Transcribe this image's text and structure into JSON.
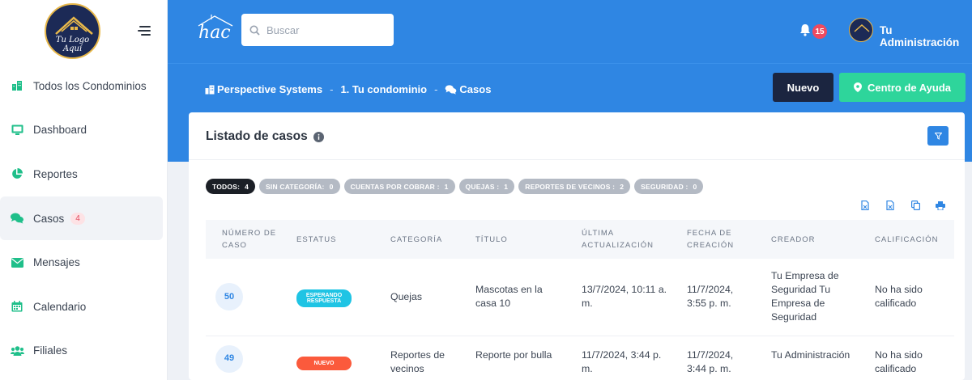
{
  "sidebar": {
    "logo_text": "Tu Logo Aquí",
    "items": [
      {
        "label": "Todos los Condominios",
        "icon": "buildings-icon",
        "active": false
      },
      {
        "label": "Dashboard",
        "icon": "monitor-icon",
        "active": false
      },
      {
        "label": "Reportes",
        "icon": "pie-chart-icon",
        "active": false
      },
      {
        "label": "Casos",
        "icon": "chat-bubbles-icon",
        "active": true,
        "badge": "4"
      },
      {
        "label": "Mensajes",
        "icon": "envelope-icon",
        "active": false
      },
      {
        "label": "Calendario",
        "icon": "calendar-icon",
        "active": false
      },
      {
        "label": "Filiales",
        "icon": "users-icon",
        "active": false
      }
    ]
  },
  "topbar": {
    "brand": "hac",
    "search_placeholder": "Buscar",
    "notifications_count": "15",
    "user_name": "Tu Administración"
  },
  "breadcrumb": {
    "item1": "Perspective Systems",
    "item2": "1. Tu condominio",
    "item3": "Casos",
    "sep1": "-",
    "sep2": "-"
  },
  "actions": {
    "nuevo": "Nuevo",
    "help": "Centro de Ayuda"
  },
  "card": {
    "title": "Listado de casos",
    "chips": [
      {
        "label": "TODOS:",
        "count": "4",
        "active": true
      },
      {
        "label": "SIN CATEGORÍA:",
        "count": "0",
        "active": false
      },
      {
        "label": "CUENTAS POR COBRAR :",
        "count": "1",
        "active": false
      },
      {
        "label": "QUEJAS :",
        "count": "1",
        "active": false
      },
      {
        "label": "REPORTES DE VECINOS :",
        "count": "2",
        "active": false
      },
      {
        "label": "SEGURIDAD :",
        "count": "0",
        "active": false
      }
    ]
  },
  "table": {
    "columns": [
      "NÚMERO DE CASO",
      "ESTATUS",
      "CATEGORÍA",
      "TÍTULO",
      "ÚLTIMA ACTUALIZACIÓN",
      "FECHA DE CREACIÓN",
      "CREADOR",
      "CALIFICACIÓN"
    ],
    "rows": [
      {
        "number": "50",
        "status": "ESPERANDO RESPUESTA",
        "status_color": "#1fc4e4",
        "category": "Quejas",
        "title": "Mascotas en la casa 10",
        "updated": "13/7/2024, 10:11 a. m.",
        "created": "11/7/2024, 3:55 p. m.",
        "creator": "Tu Empresa de Seguridad Tu Empresa de Seguridad",
        "rating": "No ha sido calificado"
      },
      {
        "number": "49",
        "status": "NUEVO",
        "status_color": "#fb5a3c",
        "category": "Reportes de vecinos",
        "title": "Reporte por bulla",
        "updated": "11/7/2024, 3:44 p. m.",
        "created": "11/7/2024, 3:44 p. m.",
        "creator": "Tu Administración",
        "rating": "No ha sido calificado"
      }
    ]
  },
  "colors": {
    "primary": "#2f86e3",
    "accent_green": "#2ed59b",
    "dark_button": "#1b2540",
    "sidebar_icon": "#1fbf8a"
  }
}
